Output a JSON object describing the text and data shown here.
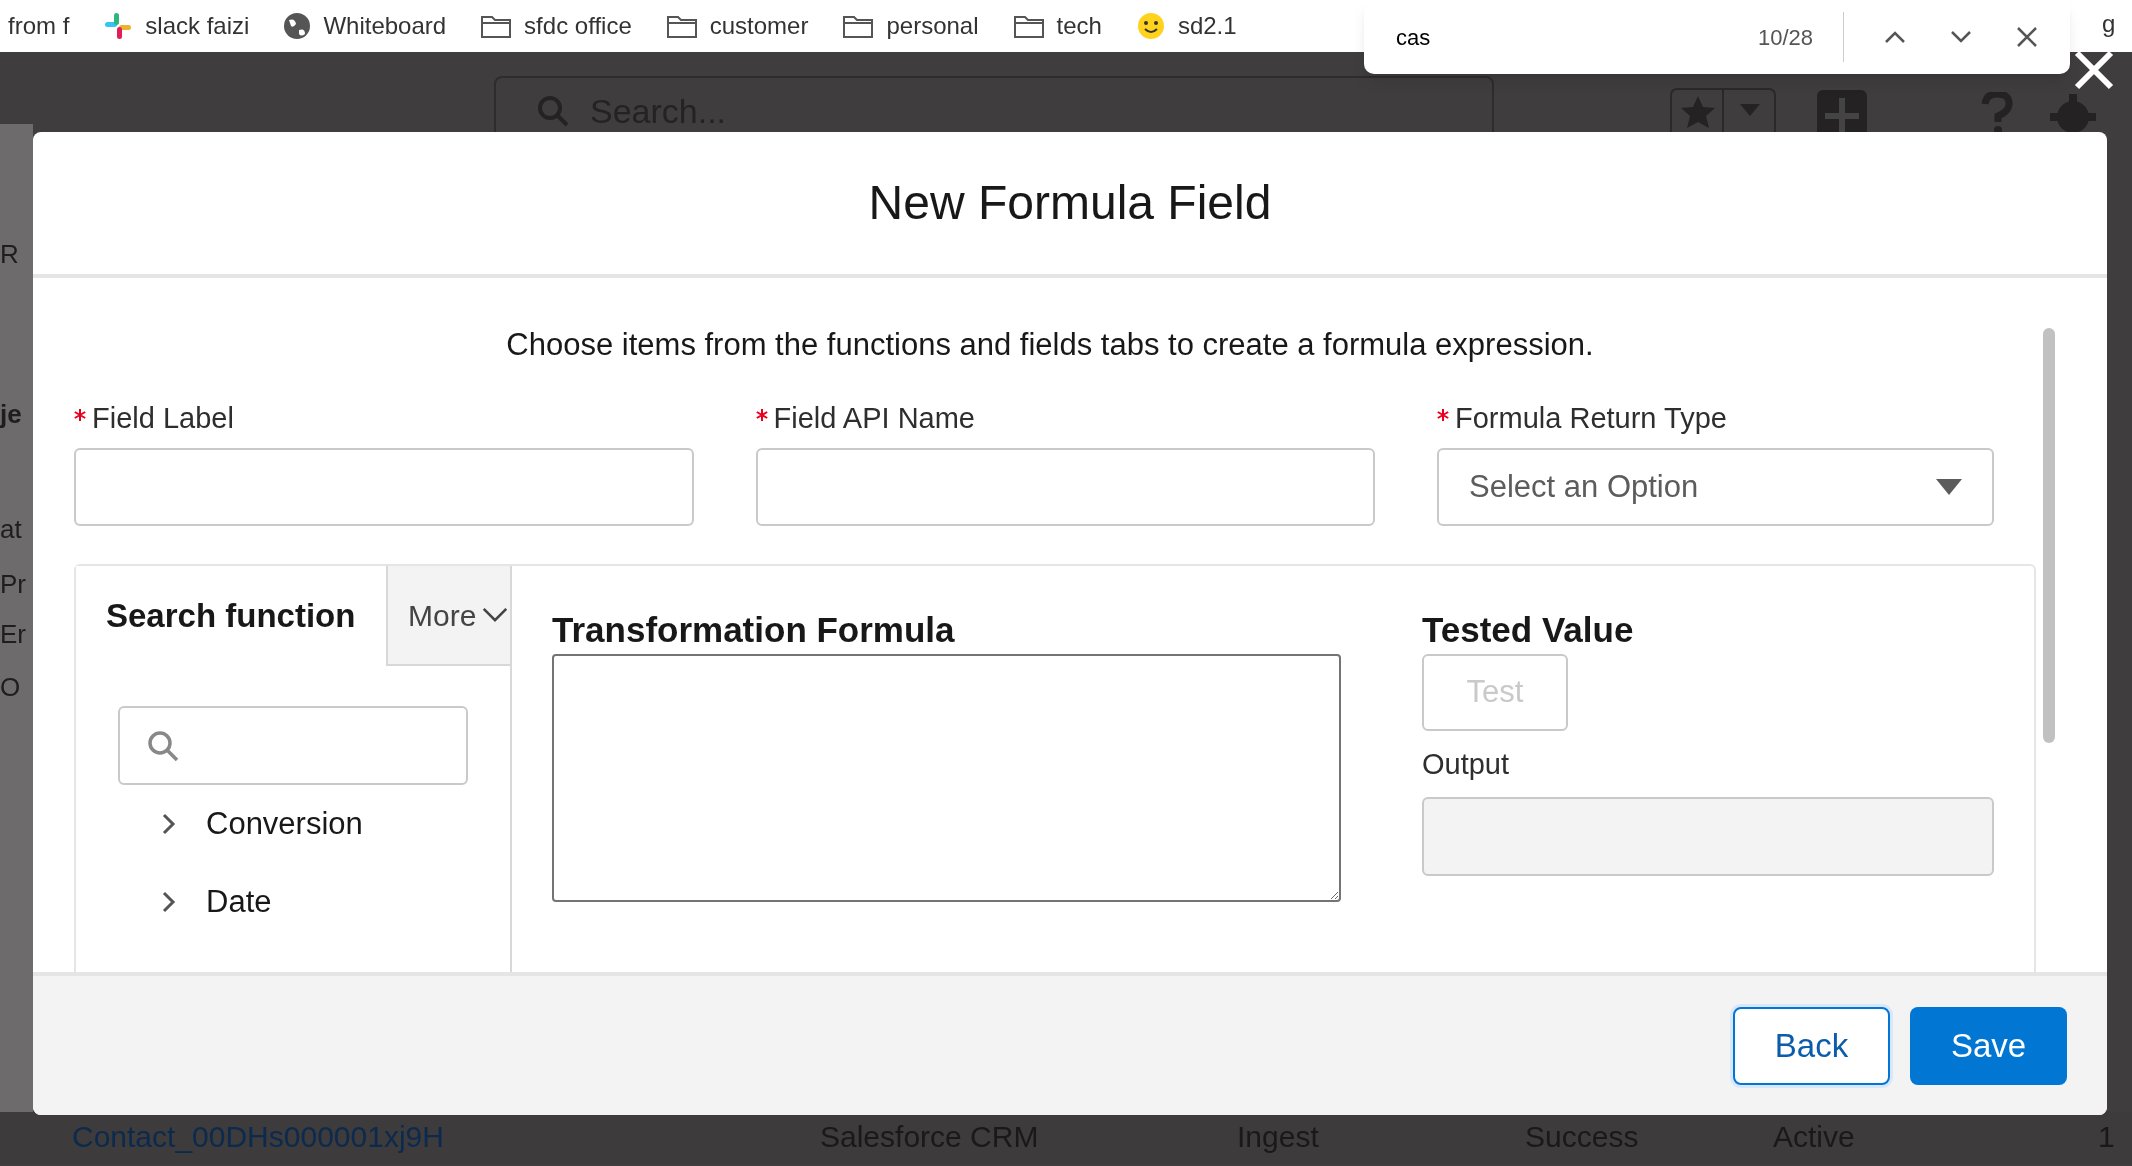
{
  "bookmarks": [
    {
      "label": "from f",
      "kind": "plain"
    },
    {
      "label": "slack faizi",
      "kind": "slack"
    },
    {
      "label": "Whiteboard",
      "kind": "globe"
    },
    {
      "label": "sfdc office",
      "kind": "folder"
    },
    {
      "label": "customer",
      "kind": "folder"
    },
    {
      "label": "personal",
      "kind": "folder"
    },
    {
      "label": "tech",
      "kind": "folder"
    },
    {
      "label": "sd2.1",
      "kind": "emoji"
    }
  ],
  "bookmarks_right": "g",
  "find_bar": {
    "query": "cas",
    "count": "10/28"
  },
  "background": {
    "search_placeholder": "Search...",
    "fragments": [
      "R",
      "je",
      "at",
      "Pr",
      "Er",
      "O"
    ],
    "row": [
      "Contact_00DHs000001xj9H",
      "Salesforce CRM",
      "Ingest",
      "Success",
      "Active",
      "1"
    ]
  },
  "modal": {
    "title": "New Formula Field",
    "instruction": "Choose items from the functions and fields tabs to create a formula expression.",
    "fields": [
      {
        "label": "Field Label",
        "required": true,
        "kind": "text"
      },
      {
        "label": "Field API Name",
        "required": true,
        "kind": "text"
      },
      {
        "label": "Formula Return Type",
        "required": true,
        "kind": "select",
        "placeholder": "Select an Option"
      }
    ],
    "tabs": [
      {
        "label": "Search function",
        "selected": true
      },
      {
        "label": "More",
        "selected": false
      }
    ],
    "categories": [
      {
        "label": "Conversion",
        "expanded": false
      },
      {
        "label": "Date",
        "expanded": false
      }
    ],
    "formula_heading": "Transformation Formula",
    "tested_heading": "Tested Value",
    "test_button": {
      "label": "Test",
      "disabled": true
    },
    "output_label": "Output",
    "buttons": [
      {
        "label": "Back",
        "kind": "neutral"
      },
      {
        "label": "Save",
        "kind": "brand"
      }
    ]
  }
}
